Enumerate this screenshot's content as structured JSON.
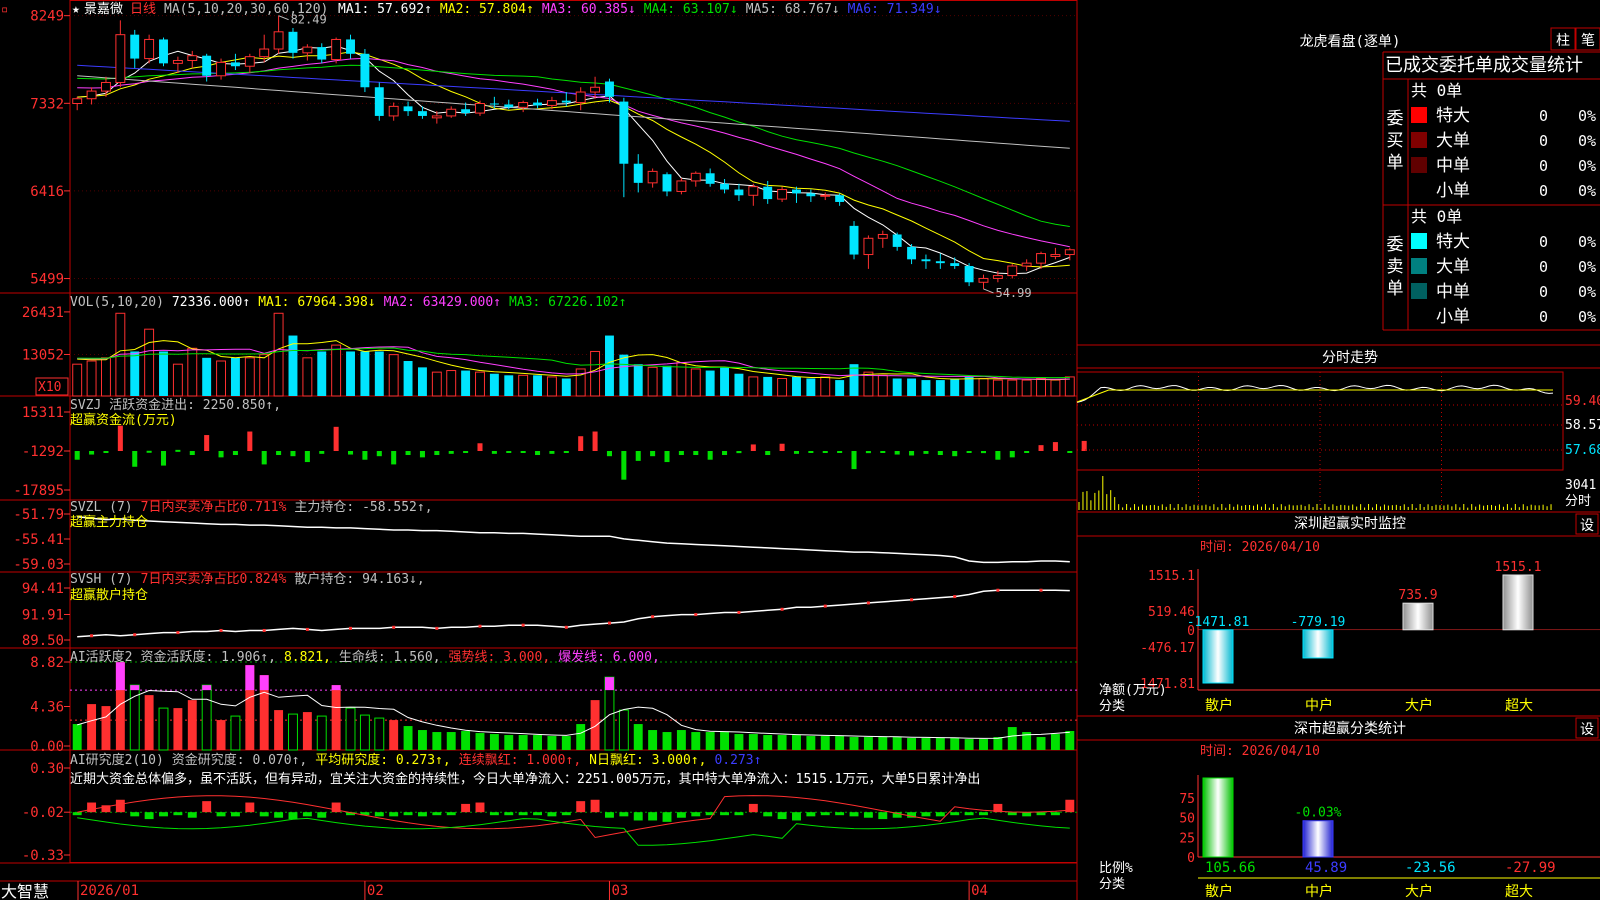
{
  "stock": {
    "name": "景嘉微",
    "period": "日线",
    "star": "★"
  },
  "colors": {
    "up": "#ff3030",
    "down": "#00e5ff",
    "frame": "#c00000",
    "white": "#ffffff",
    "yellow": "#ffff00",
    "magenta": "#ff40ff",
    "green": "#00e000",
    "blue": "#3c3cff",
    "gray": "#c0c0c0"
  },
  "ma_header": {
    "label": "MA(5,10,20,30,60,120)",
    "items": [
      {
        "text": "MA1: 57.692↑",
        "color": "#ffffff"
      },
      {
        "text": "MA2: 57.804↑",
        "color": "#ffff00"
      },
      {
        "text": "MA3: 60.385↓",
        "color": "#ff40ff"
      },
      {
        "text": "MA4: 63.107↓",
        "color": "#00e000"
      },
      {
        "text": "MA5: 68.767↓",
        "color": "#c0c0c0"
      },
      {
        "text": "MA6: 71.349↓",
        "color": "#3c3cff"
      }
    ]
  },
  "price_axis": [
    "8249",
    "7332",
    "6416",
    "5499"
  ],
  "price_marks": {
    "high": "82.49",
    "low": "54.99"
  },
  "vol_panel": {
    "axis": [
      "26431",
      "13052"
    ],
    "unit": "X10",
    "items": [
      {
        "text": "VOL(5,10,20)",
        "color": "#c0c0c0"
      },
      {
        "text": "72336.000↑",
        "color": "#ffffff"
      },
      {
        "text": "MA1: 67964.398↓",
        "color": "#ffff00"
      },
      {
        "text": "MA2: 63429.000↑",
        "color": "#ff40ff"
      },
      {
        "text": "MA3: 67226.102↑",
        "color": "#00e000"
      }
    ]
  },
  "svzj_panel": {
    "axis": [
      "15311",
      "-1292",
      "-17895"
    ],
    "items": [
      {
        "text": "SVZJ  活跃资金进出: 2250.850↑,",
        "color": "#c0c0c0"
      }
    ],
    "subtitle": "超赢资金流(万元)"
  },
  "svzl_panel": {
    "axis": [
      "-51.79",
      "-55.41",
      "-59.03"
    ],
    "items": [
      {
        "text": "SVZL (7)",
        "color": "#c0c0c0"
      },
      {
        "text": "7日内买卖净占比0.711%",
        "color": "#ff3030"
      },
      {
        "text": "主力持仓: -58.552↑,",
        "color": "#c0c0c0"
      }
    ],
    "subtitle": "超赢主力持仓"
  },
  "svsh_panel": {
    "axis": [
      "94.41",
      "91.91",
      "89.50"
    ],
    "items": [
      {
        "text": "SVSH (7)",
        "color": "#c0c0c0"
      },
      {
        "text": "7日内买卖净占比0.824%",
        "color": "#ff3030"
      },
      {
        "text": "散户持仓: 94.163↓,",
        "color": "#c0c0c0"
      }
    ],
    "subtitle": "超赢散户持仓"
  },
  "ai_active_panel": {
    "axis": [
      "8.82",
      "4.36",
      "0.00"
    ],
    "items": [
      {
        "text": "AI活跃度2",
        "color": "#c0c0c0"
      },
      {
        "text": "资金活跃度: 1.906↑,",
        "color": "#c0c0c0"
      },
      {
        "text": "8.821,",
        "color": "#ffff00"
      },
      {
        "text": "生命线: 1.560,",
        "color": "#c0c0c0"
      },
      {
        "text": "强势线: 3.000,",
        "color": "#ff3030"
      },
      {
        "text": "爆发线: 6.000,",
        "color": "#ff40ff"
      }
    ]
  },
  "ai_research_panel": {
    "axis": [
      "0.30",
      "-0.02",
      "-0.33"
    ],
    "items": [
      {
        "text": "AI研究度2(10)",
        "color": "#c0c0c0"
      },
      {
        "text": "资金研究度: 0.070↑,",
        "color": "#c0c0c0"
      },
      {
        "text": "平均研究度: 0.273↑,",
        "color": "#ffff00"
      },
      {
        "text": "连续飘红: 1.000↑,",
        "color": "#ff3030"
      },
      {
        "text": "N日飘红: 3.000↑,",
        "color": "#ffff00"
      },
      {
        "text": "0.273↑",
        "color": "#3c3cff"
      }
    ],
    "comment": "近期大资金总体偏多，虽不活跃，但有异动，宜关注大资金的持续性，今日大单净流入：2251.005万元，其中特大单净流入：1515.1万元，大单5日累计净出"
  },
  "x_axis": {
    "labels": [
      "2026/01",
      "02",
      "03",
      "04"
    ]
  },
  "brand": "大智慧",
  "longhu": {
    "title": "龙虎看盘(逐单)",
    "tabs": [
      "柱",
      "笔"
    ],
    "subtitle": "已成交委托单成交量统计",
    "buy": {
      "side": "委买单",
      "total": "共 0单",
      "rows": [
        {
          "name": "特大",
          "color": "#ff0000",
          "count": "0",
          "pct": "0%"
        },
        {
          "name": "大单",
          "color": "#800000",
          "count": "0",
          "pct": "0%"
        },
        {
          "name": "中单",
          "color": "#600000",
          "count": "0",
          "pct": "0%"
        },
        {
          "name": "小单",
          "color": "",
          "count": "0",
          "pct": "0%"
        }
      ]
    },
    "sell": {
      "side": "委卖单",
      "total": "共 0单",
      "rows": [
        {
          "name": "特大",
          "color": "#00ffff",
          "count": "0",
          "pct": "0%"
        },
        {
          "name": "大单",
          "color": "#008080",
          "count": "0",
          "pct": "0%"
        },
        {
          "name": "中单",
          "color": "#006060",
          "count": "0",
          "pct": "0%"
        },
        {
          "name": "小单",
          "color": "",
          "count": "0",
          "pct": "0%"
        }
      ]
    }
  },
  "intraday": {
    "title": "分时走势",
    "axis": [
      "59.40",
      "58.57",
      "57.68"
    ],
    "vol_axis": "3041",
    "vol_label": "分时"
  },
  "monitor": {
    "title": "深圳超赢实时监控",
    "settings": "设",
    "time": "时间: 2026/04/10",
    "axis": [
      "1515.1",
      "519.46",
      "0",
      "-476.17",
      "-1471.81"
    ],
    "ylabel": "净额(万元)",
    "xlabel": "分类",
    "bars": [
      {
        "name": "散户",
        "value": -1471.81,
        "label": "-1471.81"
      },
      {
        "name": "中户",
        "value": -779.19,
        "label": "-779.19"
      },
      {
        "name": "大户",
        "value": 735.9,
        "label": "735.9"
      },
      {
        "name": "超大",
        "value": 1515.1,
        "label": "1515.1"
      }
    ]
  },
  "classify": {
    "title": "深市超赢分类统计",
    "settings": "设",
    "time": "时间: 2026/04/10",
    "axis": [
      "75",
      "50",
      "25",
      "0"
    ],
    "ylabel": "比例%",
    "xlabel": "分类",
    "bars": [
      {
        "name": "散户",
        "value": 105.66,
        "label": "105.66"
      },
      {
        "name": "中户",
        "value": 45.89,
        "label": "45.89",
        "top_label": "-0.03%"
      },
      {
        "name": "大户",
        "value": -23.56,
        "label": "-23.56"
      },
      {
        "name": "超大",
        "value": -27.99,
        "label": "-27.99"
      }
    ]
  },
  "chart_data": {
    "type": "candlestick",
    "price_range": [
      54.99,
      82.49
    ],
    "ohlc": [
      [
        73.3,
        74.0,
        72.6,
        73.8
      ],
      [
        73.8,
        75.0,
        73.2,
        74.6
      ],
      [
        74.6,
        76.1,
        74.0,
        75.5
      ],
      [
        75.5,
        82.0,
        75.0,
        80.5
      ],
      [
        80.5,
        81.0,
        77.0,
        78.0
      ],
      [
        78.0,
        80.5,
        77.5,
        80.0
      ],
      [
        80.0,
        80.2,
        77.2,
        77.5
      ],
      [
        77.5,
        78.2,
        76.5,
        77.8
      ],
      [
        77.8,
        78.8,
        77.0,
        78.3
      ],
      [
        78.3,
        78.5,
        75.6,
        76.2
      ],
      [
        76.2,
        78.0,
        75.8,
        77.6
      ],
      [
        77.6,
        78.5,
        76.8,
        77.2
      ],
      [
        77.2,
        78.5,
        76.5,
        78.2
      ],
      [
        78.2,
        80.5,
        77.6,
        79.0
      ],
      [
        79.0,
        82.49,
        78.5,
        80.8
      ],
      [
        80.8,
        81.2,
        78.0,
        78.6
      ],
      [
        78.6,
        79.5,
        77.8,
        79.2
      ],
      [
        79.2,
        79.6,
        77.5,
        77.9
      ],
      [
        77.9,
        80.2,
        77.5,
        80.0
      ],
      [
        80.0,
        80.5,
        78.0,
        78.5
      ],
      [
        78.5,
        79.0,
        74.5,
        75.0
      ],
      [
        75.0,
        75.5,
        71.5,
        72.0
      ],
      [
        72.0,
        73.4,
        71.5,
        73.0
      ],
      [
        73.0,
        73.5,
        72.0,
        72.5
      ],
      [
        72.5,
        73.0,
        71.7,
        72.0
      ],
      [
        71.8,
        72.5,
        71.2,
        72.0
      ],
      [
        72.0,
        73.0,
        71.8,
        72.7
      ],
      [
        72.7,
        73.4,
        72.0,
        72.3
      ],
      [
        72.3,
        73.6,
        72.0,
        73.3
      ],
      [
        73.3,
        74.0,
        72.8,
        73.2
      ],
      [
        73.2,
        73.7,
        72.7,
        72.9
      ],
      [
        72.9,
        73.6,
        72.4,
        73.4
      ],
      [
        73.4,
        73.8,
        72.8,
        73.1
      ],
      [
        73.1,
        74.0,
        72.7,
        73.6
      ],
      [
        73.6,
        74.5,
        73.0,
        73.4
      ],
      [
        73.4,
        75.0,
        72.6,
        74.5
      ],
      [
        74.5,
        76.1,
        73.8,
        75.0
      ],
      [
        75.6,
        75.9,
        73.4,
        74.0
      ],
      [
        73.5,
        73.9,
        63.5,
        67.0
      ],
      [
        67.0,
        68.0,
        64.0,
        65.0
      ],
      [
        65.0,
        66.5,
        64.5,
        66.2
      ],
      [
        65.9,
        66.1,
        63.6,
        64.1
      ],
      [
        64.1,
        65.5,
        63.8,
        65.2
      ],
      [
        65.2,
        66.2,
        64.6,
        66.0
      ],
      [
        66.0,
        66.5,
        64.6,
        64.9
      ],
      [
        64.9,
        65.4,
        63.9,
        64.3
      ],
      [
        64.3,
        64.9,
        63.1,
        63.7
      ],
      [
        63.7,
        64.9,
        62.6,
        64.6
      ],
      [
        64.6,
        65.2,
        62.8,
        63.3
      ],
      [
        63.3,
        64.6,
        63.0,
        64.3
      ],
      [
        64.3,
        64.6,
        62.9,
        63.9
      ],
      [
        63.9,
        64.3,
        63.0,
        63.6
      ],
      [
        63.6,
        64.0,
        63.2,
        63.7
      ],
      [
        63.7,
        63.9,
        62.6,
        63.0
      ],
      [
        60.5,
        61.0,
        57.0,
        57.5
      ],
      [
        57.5,
        59.5,
        56.0,
        59.2
      ],
      [
        59.2,
        60.0,
        58.2,
        59.6
      ],
      [
        59.6,
        59.8,
        57.9,
        58.3
      ],
      [
        58.3,
        58.6,
        56.5,
        57.0
      ],
      [
        57.0,
        57.5,
        56.0,
        56.8
      ],
      [
        56.8,
        57.6,
        56.0,
        56.6
      ],
      [
        56.6,
        57.2,
        56.0,
        56.3
      ],
      [
        56.3,
        56.6,
        54.2,
        54.6
      ],
      [
        54.6,
        55.4,
        53.9,
        55.0
      ],
      [
        55.0,
        55.8,
        54.6,
        55.3
      ],
      [
        55.3,
        56.5,
        55.0,
        56.3
      ],
      [
        56.3,
        57.0,
        55.8,
        56.6
      ],
      [
        56.6,
        57.8,
        56.0,
        57.6
      ],
      [
        57.3,
        58.2,
        57.0,
        57.5
      ],
      [
        57.5,
        58.2,
        56.9,
        58.0
      ]
    ],
    "volume": [
      1.0,
      1.1,
      1.2,
      2.6,
      1.4,
      2.1,
      1.4,
      1.0,
      1.5,
      1.2,
      1.1,
      1.2,
      1.2,
      1.3,
      2.6,
      1.9,
      1.2,
      1.4,
      1.6,
      1.4,
      1.4,
      1.4,
      1.3,
      1.1,
      0.9,
      0.75,
      0.8,
      0.8,
      0.75,
      0.7,
      0.65,
      0.65,
      0.65,
      0.6,
      0.55,
      0.85,
      1.4,
      1.9,
      1.3,
      1.0,
      0.9,
      0.95,
      1.05,
      0.85,
      0.8,
      0.9,
      0.7,
      0.6,
      0.6,
      0.55,
      0.6,
      0.55,
      0.6,
      0.5,
      1.0,
      0.75,
      0.65,
      0.55,
      0.55,
      0.5,
      0.5,
      0.55,
      0.6,
      0.55,
      0.5,
      0.5,
      0.5,
      0.55,
      0.5,
      0.6
    ],
    "svzj": [
      -5000,
      -2800,
      -2000,
      9500,
      -8000,
      -1200,
      -7500,
      -800,
      -3000,
      5500,
      -4000,
      -3000,
      7000,
      -7000,
      -3000,
      -3500,
      -6000,
      -2500,
      9000,
      -2800,
      -5000,
      -3500,
      -7000,
      -3000,
      -4000,
      -3000,
      -2500,
      -1800,
      2000,
      -2500,
      -2000,
      -1800,
      -3000,
      -2500,
      -1500,
      5000,
      7000,
      -3500,
      -13500,
      -5500,
      -3500,
      -6000,
      -3000,
      -3000,
      -5000,
      -3000,
      -2200,
      1500,
      -3000,
      1800,
      -2500,
      -1500,
      -1800,
      -1500,
      -9000,
      -2200,
      -1600,
      -2800,
      -3200,
      -2500,
      -3000,
      -3500,
      -1500,
      -2200,
      -5000,
      -4000,
      -1800,
      1200,
      2500,
      -1500,
      3000
    ],
    "svzl": [
      -52.2,
      -52.4,
      -52.6,
      -52.5,
      -52.7,
      -52.8,
      -52.9,
      -53.0,
      -53.1,
      -53.2,
      -53.3,
      -53.3,
      -53.4,
      -53.4,
      -53.5,
      -53.6,
      -53.7,
      -53.7,
      -53.8,
      -53.8,
      -53.9,
      -54.0,
      -54.1,
      -54.1,
      -54.2,
      -54.2,
      -54.3,
      -54.4,
      -54.5,
      -54.5,
      -54.6,
      -54.6,
      -54.7,
      -54.8,
      -54.9,
      -55.0,
      -55.0,
      -55.0,
      -55.4,
      -55.6,
      -55.8,
      -56.0,
      -56.1,
      -56.2,
      -56.3,
      -56.4,
      -56.5,
      -56.6,
      -56.7,
      -56.8,
      -56.9,
      -57.0,
      -57.1,
      -57.2,
      -57.3,
      -57.3,
      -57.4,
      -57.5,
      -57.6,
      -57.7,
      -57.8,
      -58.0,
      -58.6,
      -58.8,
      -58.8,
      -58.7,
      -58.7,
      -58.6,
      -58.6,
      -58.7
    ],
    "svsh": [
      89.8,
      89.9,
      90.0,
      89.9,
      90.0,
      90.1,
      90.2,
      90.2,
      90.3,
      90.3,
      90.4,
      90.3,
      90.4,
      90.4,
      90.5,
      90.6,
      90.5,
      90.4,
      90.5,
      90.6,
      90.6,
      90.6,
      90.7,
      90.7,
      90.7,
      90.6,
      90.7,
      90.7,
      90.8,
      90.8,
      90.9,
      90.9,
      90.9,
      90.8,
      90.7,
      90.9,
      91.0,
      91.1,
      91.2,
      91.5,
      91.7,
      91.8,
      91.9,
      91.9,
      92.0,
      92.1,
      92.1,
      92.2,
      92.3,
      92.4,
      92.6,
      92.6,
      92.7,
      92.8,
      92.9,
      93.0,
      93.1,
      93.2,
      93.3,
      93.4,
      93.5,
      93.6,
      93.8,
      94.1,
      94.2,
      94.2,
      94.2,
      94.2,
      94.2,
      94.163
    ],
    "ai_active": [
      2.6,
      4.6,
      4.4,
      8.8,
      6.5,
      5.5,
      4.2,
      4.2,
      5.0,
      6.5,
      3.0,
      3.4,
      8.5,
      7.5,
      4.0,
      3.6,
      3.8,
      3.4,
      6.5,
      4.2,
      3.5,
      3.2,
      3.0,
      2.4,
      2.0,
      1.8,
      1.8,
      1.9,
      1.7,
      1.6,
      1.5,
      1.5,
      1.5,
      1.4,
      1.4,
      2.6,
      5.0,
      7.3,
      4.0,
      2.6,
      2.0,
      1.8,
      2.0,
      1.8,
      1.8,
      1.8,
      1.6,
      1.6,
      1.5,
      1.5,
      1.5,
      1.4,
      1.4,
      1.4,
      1.3,
      1.3,
      1.3,
      1.3,
      1.2,
      1.2,
      1.2,
      1.2,
      1.1,
      1.1,
      1.3,
      2.3,
      1.8,
      1.3,
      1.6,
      1.906
    ],
    "ai_research": [
      -0.04,
      0.05,
      0.03,
      0.07,
      -0.05,
      -0.07,
      -0.05,
      -0.04,
      -0.06,
      0.06,
      -0.05,
      -0.05,
      0.05,
      -0.05,
      -0.06,
      -0.07,
      -0.05,
      -0.06,
      0.05,
      -0.04,
      -0.04,
      -0.05,
      -0.05,
      -0.04,
      -0.05,
      -0.04,
      -0.04,
      0.04,
      0.05,
      -0.04,
      -0.04,
      -0.04,
      -0.04,
      -0.05,
      -0.03,
      0.06,
      0.07,
      -0.06,
      -0.05,
      -0.08,
      -0.08,
      -0.09,
      -0.06,
      -0.05,
      -0.04,
      -0.04,
      -0.04,
      0.04,
      -0.05,
      -0.07,
      -0.08,
      -0.05,
      -0.04,
      -0.04,
      -0.05,
      -0.06,
      -0.07,
      -0.06,
      -0.06,
      -0.05,
      -0.05,
      -0.04,
      -0.04,
      -0.03,
      0.04,
      -0.04,
      -0.05,
      -0.04,
      -0.03,
      0.07
    ]
  }
}
